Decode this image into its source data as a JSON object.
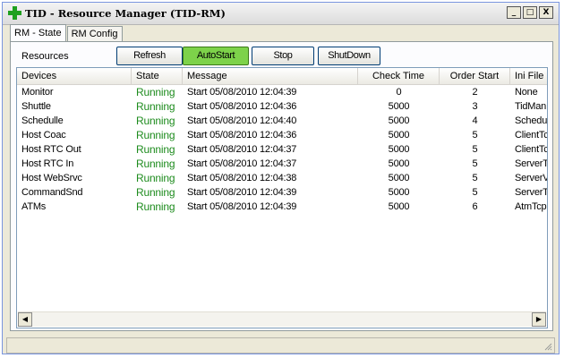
{
  "window": {
    "title": "TID - Resource Manager (TID-RM)",
    "min_label": "_",
    "max_label": "□",
    "close_label": "X"
  },
  "tabs": [
    {
      "label": "RM - State",
      "active": true
    },
    {
      "label": "RM Config",
      "active": false
    }
  ],
  "toolbar": {
    "resources_label": "Resources",
    "refresh_label": "Refresh",
    "autostart_label": "AutoStart",
    "stop_label": "Stop",
    "shutdown_label": "ShutDown",
    "autostart_color": "#7dd24a"
  },
  "grid": {
    "columns": [
      "Devices",
      "State",
      "Message",
      "Check Time",
      "Order Start",
      "Ini File"
    ],
    "rows": [
      {
        "device": "Monitor",
        "state": "Running",
        "message": "Start 05/08/2010 12:04:39",
        "check_time": "0",
        "order_start": "2",
        "ini_file": "None"
      },
      {
        "device": "Shuttle",
        "state": "Running",
        "message": "Start 05/08/2010 12:04:36",
        "check_time": "5000",
        "order_start": "3",
        "ini_file": "TidMan"
      },
      {
        "device": "Schedulle",
        "state": "Running",
        "message": "Start 05/08/2010 12:04:40",
        "check_time": "5000",
        "order_start": "4",
        "ini_file": "Schedu"
      },
      {
        "device": "Host Coac",
        "state": "Running",
        "message": "Start 05/08/2010 12:04:36",
        "check_time": "5000",
        "order_start": "5",
        "ini_file": "ClientTc"
      },
      {
        "device": "Host RTC Out",
        "state": "Running",
        "message": "Start 05/08/2010 12:04:37",
        "check_time": "5000",
        "order_start": "5",
        "ini_file": "ClientTc"
      },
      {
        "device": "Host RTC In",
        "state": "Running",
        "message": "Start 05/08/2010 12:04:37",
        "check_time": "5000",
        "order_start": "5",
        "ini_file": "ServerT"
      },
      {
        "device": "Host WebSrvc",
        "state": "Running",
        "message": "Start 05/08/2010 12:04:38",
        "check_time": "5000",
        "order_start": "5",
        "ini_file": "ServerV"
      },
      {
        "device": "CommandSnd",
        "state": "Running",
        "message": "Start 05/08/2010 12:04:39",
        "check_time": "5000",
        "order_start": "5",
        "ini_file": "ServerT"
      },
      {
        "device": "ATMs",
        "state": "Running",
        "message": "Start 05/08/2010 12:04:39",
        "check_time": "5000",
        "order_start": "6",
        "ini_file": "AtmTcp"
      }
    ],
    "state_color": "#1e8c1e"
  },
  "icons": {
    "app": "green-plus-icon",
    "scroll_left": "scroll-left-icon",
    "scroll_right": "scroll-right-icon",
    "grip": "resize-grip-icon"
  }
}
